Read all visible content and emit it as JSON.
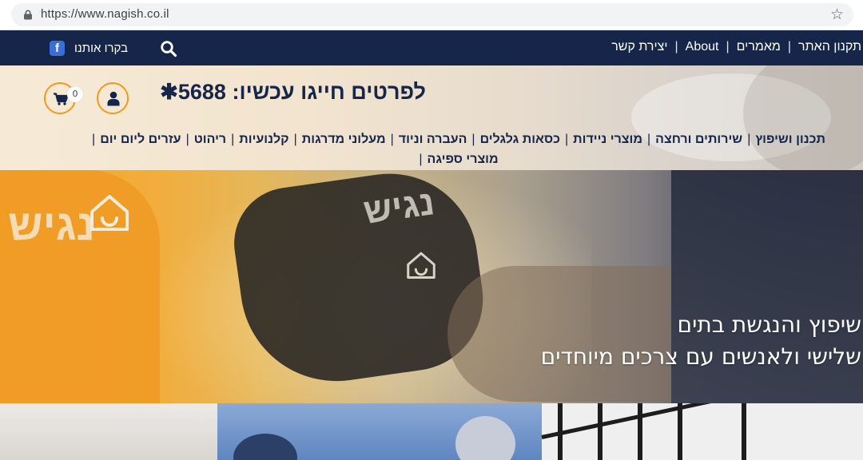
{
  "browser": {
    "url": "https://www.nagish.co.il",
    "lock_icon": "lock-icon",
    "bookmark_icon": "star-icon"
  },
  "topbar": {
    "links": [
      "תקנון האתר",
      "מאמרים",
      "About",
      "יצירת קשר"
    ],
    "separator": "|",
    "search_icon": "search-icon",
    "visit_label": "בקרו אותנו",
    "facebook_icon": "facebook-icon",
    "facebook_letter": "f",
    "bg_color": "#16264a"
  },
  "header": {
    "phone_text": "לפרטים חייגו עכשיו: 5688✱",
    "cart_icon": "cart-icon",
    "cart_count": "0",
    "user_icon": "user-icon",
    "accent_color": "#f39a1c",
    "categories": [
      "תכנון ושיפוץ",
      "שירותים ורחצה",
      "מוצרי ניידות",
      "כסאות גלגלים",
      "העברה וניוד",
      "מעלוני מדרגות",
      "קלנועיות",
      "ריהוט",
      "עזרים ליום יום",
      "מוצרי ספיגה"
    ],
    "separator": "|"
  },
  "hero": {
    "line1": "שיפוץ והנגשת בתים",
    "line2": "שלישי ולאנשים עם צרכים מיוחדים",
    "logo_text": "נגיש"
  }
}
